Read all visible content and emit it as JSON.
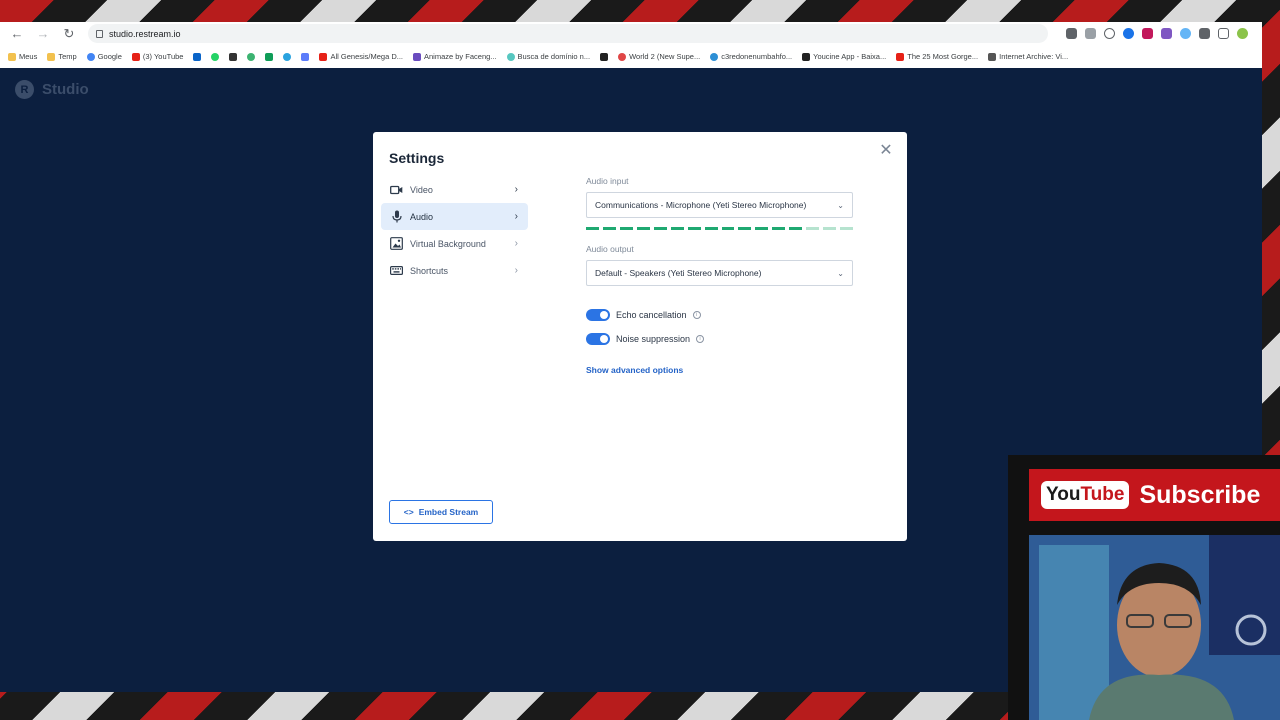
{
  "browser": {
    "url": "studio.restream.io",
    "bookmarks": [
      {
        "label": "Meus",
        "color": "#f2c14e"
      },
      {
        "label": "Temp",
        "color": "#f2c14e"
      },
      {
        "label": "Google",
        "color": "#4285f4"
      },
      {
        "label": "(3) YouTube",
        "color": "#e62117"
      },
      {
        "label": "All Genesis/Mega D...",
        "color": "#e62117"
      },
      {
        "label": "Animaze by Faceng...",
        "color": "#6a4cbf"
      },
      {
        "label": "Busca de domínio n...",
        "color": "#57c7c0"
      },
      {
        "label": "World 2 (New Supe...",
        "color": "#e04646"
      },
      {
        "label": "c3redonenumbahfo...",
        "color": "#2d8fd5"
      },
      {
        "label": "Youcine App - Baixa...",
        "color": "#222222"
      },
      {
        "label": "The 25 Most Gorge...",
        "color": "#e62117"
      },
      {
        "label": "Internet Archive: Vi...",
        "color": "#555555"
      }
    ]
  },
  "app": {
    "brand": "Studio",
    "brand_letter": "R"
  },
  "settings": {
    "title": "Settings",
    "menu": [
      {
        "label": "Video",
        "icon": "video-camera-icon",
        "active": false
      },
      {
        "label": "Audio",
        "icon": "microphone-icon",
        "active": true
      },
      {
        "label": "Virtual Background",
        "icon": "virtual-background-icon",
        "active": false
      },
      {
        "label": "Shortcuts",
        "icon": "keyboard-icon",
        "active": false
      }
    ],
    "audio_input_label": "Audio input",
    "audio_input_value": "Communications - Microphone (Yeti Stereo Microphone)",
    "audio_output_label": "Audio output",
    "audio_output_value": "Default - Speakers (Yeti Stereo Microphone)",
    "echo_label": "Echo cancellation",
    "noise_label": "Noise suppression",
    "advanced_link": "Show advanced options",
    "embed_button": "Embed Stream"
  },
  "overlay": {
    "yt_you": "You",
    "yt_tube": "Tube",
    "subscribe": "Subscribe"
  },
  "colors": {
    "app_background": "#0c1f3f",
    "accent": "#2b74e4",
    "meter": "#1fa971"
  }
}
